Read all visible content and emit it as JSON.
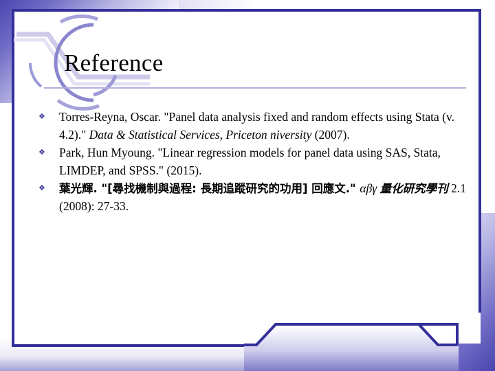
{
  "slide": {
    "title": "Reference",
    "bullet_marker": "❖",
    "accent_navy": "#332f9a",
    "accent_periwinkle": "#b3b0dd",
    "accent_arc": "#8b87cf",
    "text_color": "#000000",
    "background": "#ffffff"
  },
  "references": [
    {
      "marker": "❖",
      "segments": [
        {
          "text": "Torres-Reyna, Oscar. \"Panel data analysis fixed and random effects using Stata (v. 4.2).\" ",
          "style": "normal"
        },
        {
          "text": "Data & Statistical Services, Priceton niversity",
          "style": "italic"
        },
        {
          "text": " (2007).",
          "style": "normal"
        }
      ],
      "plain": "Torres-Reyna, Oscar. \"Panel data analysis fixed and random effects using Stata (v. 4.2).\" Data & Statistical Services, Priceton niversity (2007)."
    },
    {
      "marker": "❖",
      "segments": [
        {
          "text": "Park, Hun Myoung. \"Linear regression models for panel data using SAS, Stata, LIMDEP, and SPSS.\" (2015).",
          "style": "normal"
        }
      ],
      "plain": "Park, Hun Myoung. \"Linear regression models for panel data using SAS, Stata, LIMDEP, and SPSS.\" (2015)."
    },
    {
      "marker": "❖",
      "segments": [
        {
          "text": "葉光輝. \"[尋找機制與過程: 長期追蹤研究的功用] 回應文.\" ",
          "style": "cjk"
        },
        {
          "text": "αβγ ",
          "style": "italic"
        },
        {
          "text": "量化研究學刊",
          "style": "cjk-italic"
        },
        {
          "text": " 2.1 (2008): 27-33.",
          "style": "normal"
        }
      ],
      "plain": "葉光輝. \"[尋找機制與過程: 長期追蹤研究的功用] 回應文.\" αβγ 量化研究學刊 2.1 (2008): 27-33."
    }
  ]
}
